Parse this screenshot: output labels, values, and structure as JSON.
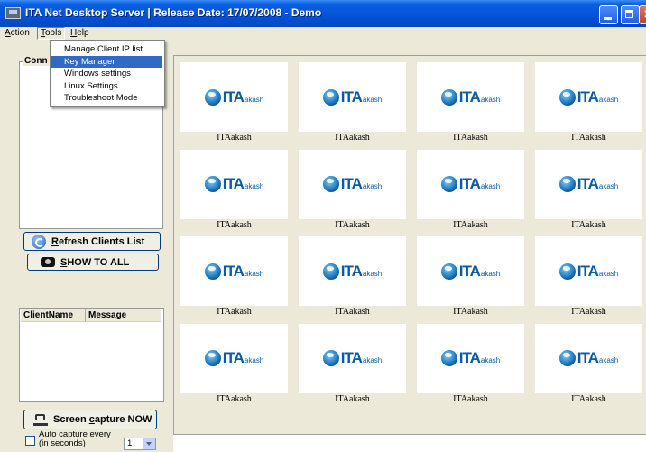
{
  "window": {
    "title": "ITA Net Desktop Server  |  Release Date: 17/07/2008 - Demo"
  },
  "menubar": {
    "items": [
      "Action",
      "Tools",
      "Help"
    ]
  },
  "tools_menu": {
    "items": [
      {
        "label": "Manage Client IP list",
        "highlighted": false
      },
      {
        "label": "Key Manager",
        "highlighted": true
      },
      {
        "label": "Windows settings",
        "highlighted": false
      },
      {
        "label": "Linux Settings",
        "highlighted": false
      },
      {
        "label": "Troubleshoot Mode",
        "highlighted": false
      }
    ]
  },
  "left_panel": {
    "connected_label": "Conn",
    "refresh_button": "Refresh Clients List",
    "show_all_button": "SHOW TO ALL",
    "message_list_headers": [
      "ClientName",
      "Message"
    ],
    "capture_button_pre": "Screen ",
    "capture_button_u": "c",
    "capture_button_post": "apture NOW",
    "auto_capture_line1": "Auto capture every",
    "auto_capture_line2": "(in seconds)",
    "interval_value": "1"
  },
  "grid": {
    "logo_main": "ITA",
    "logo_sub": "akash",
    "tiles": [
      "ITAakash",
      "ITAakash",
      "ITAakash",
      "ITAakash",
      "ITAakash",
      "ITAakash",
      "ITAakash",
      "ITAakash",
      "ITAakash",
      "ITAakash",
      "ITAakash",
      "ITAakash",
      "ITAakash",
      "ITAakash",
      "ITAakash",
      "ITAakash"
    ]
  },
  "colors": {
    "titlebar": "#0553d6",
    "menu_highlight": "#316ac5",
    "logo_blue": "#0b5aa6"
  },
  "icons": {
    "refresh": "refresh-globe-icon",
    "show_all": "eye-icon",
    "capture": "camera-icon"
  }
}
